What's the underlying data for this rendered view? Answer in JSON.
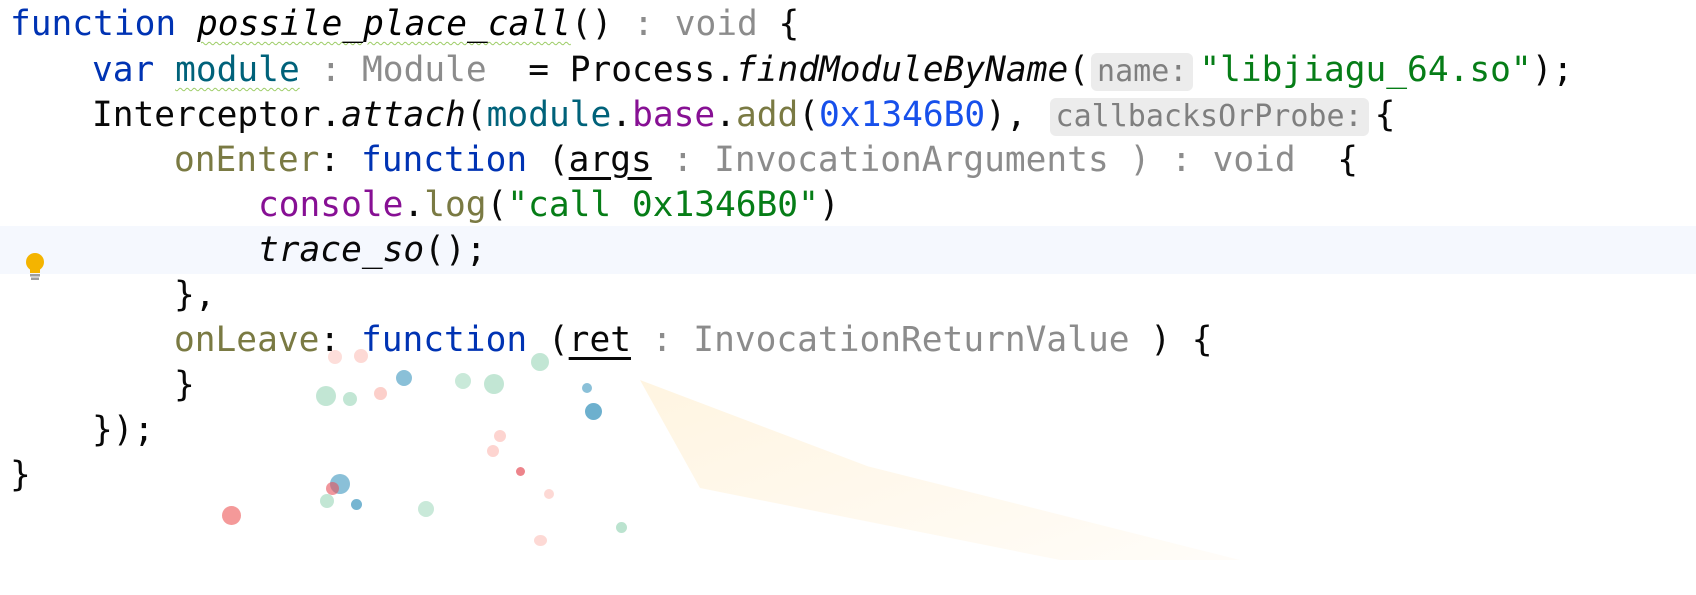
{
  "code_lines": {
    "l1": {
      "kw_function": "function",
      "fn_name": "possile_place_call",
      "parens": "()",
      "colon": " : ",
      "ret_type": "void",
      "brace": " {"
    },
    "l2": {
      "kw_var": "var",
      "var_name": "module",
      "colon": " : ",
      "type": "Module",
      "assign": "  = Process.",
      "method": "findModuleByName",
      "open": "(",
      "hint": "name:",
      "str": "\"libjiagu_64.so\"",
      "close": ");"
    },
    "l3": {
      "obj": "Interceptor.",
      "method": "attach",
      "open": "(",
      "mod": "module",
      "dot1": ".",
      "base": "base",
      "dot2": ".",
      "add": "add",
      "paren": "(",
      "num": "0x1346B0",
      "close": "), ",
      "hint": "callbacksOrProbe:",
      "brace": "{"
    },
    "l4": {
      "key": "onEnter",
      "colon": ": ",
      "kw_function": "function",
      "open": " (",
      "param": "args",
      "sep": " : ",
      "type": "InvocationArguments",
      "close": " ) : ",
      "ret": "void",
      "brace": "  {"
    },
    "l5": {
      "console": "console",
      "dot": ".",
      "log": "log",
      "open": "(",
      "str": "\"call 0x1346B0\"",
      "close": ")"
    },
    "l6": {
      "call": "trace_so",
      "rest": "();"
    },
    "l7": {
      "text": "},"
    },
    "l8": {
      "key": "onLeave",
      "colon": ": ",
      "kw_function": "function",
      "open": " (",
      "param": "ret",
      "sep": " : ",
      "type": "InvocationReturnValue",
      "close": " ) {"
    },
    "l9": {
      "text": "}"
    },
    "l10": {
      "text": "});"
    },
    "l11": {
      "text": "}"
    }
  },
  "icons": {
    "intention": "lightbulb-icon"
  },
  "colors": {
    "keyword": "#0033b3",
    "string": "#067d17",
    "number": "#1750eb",
    "hint_bg": "#ececec",
    "current_line": "#f5f8fe",
    "bulb": "#f4b400"
  }
}
